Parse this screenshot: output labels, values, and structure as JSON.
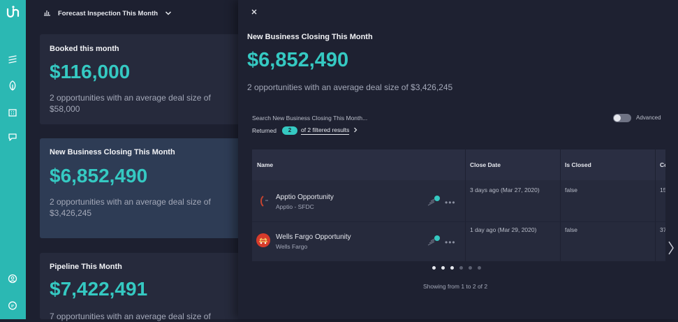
{
  "header": {
    "title": "Forecast Inspection This Month"
  },
  "cards": [
    {
      "title": "Booked this month",
      "value": "$116,000",
      "subtitle": "2 opportunities with an average deal size of $58,000"
    },
    {
      "title": "New Business Closing This Month",
      "value": "$6,852,490",
      "subtitle": "2 opportunities with an average deal size of $3,426,245"
    },
    {
      "title": "Pipeline This Month",
      "value": "$7,422,491",
      "subtitle": "7 opportunities with an average deal size of"
    }
  ],
  "panel": {
    "title": "New Business Closing This Month",
    "value": "$6,852,490",
    "subtitle": "2 opportunities with an average deal size of $3,426,245",
    "search_placeholder": "Search New Business Closing This Month...",
    "returned_label": "Returned",
    "returned_count": "2",
    "filtered_label": "of 2 filtered results",
    "advanced_label": "Advanced",
    "columns": [
      "Name",
      "Close Date",
      "Is Closed",
      "Co"
    ],
    "rows": [
      {
        "name": "Apptio Opportunity",
        "account": "Apptio - SFDC",
        "close_date": "3 days ago (Mar 27, 2020)",
        "is_closed": "false",
        "extra": "15"
      },
      {
        "name": "Wells Fargo Opportunity",
        "account": "Wells Fargo",
        "close_date": "1 day ago (Mar 29, 2020)",
        "is_closed": "false",
        "extra": "37"
      }
    ],
    "more_label": "•••",
    "showing": "Showing from 1 to 2 of 2",
    "pagination": {
      "total_dots": 6,
      "active_dots": 3
    }
  },
  "colors": {
    "accent": "#35c9c2",
    "rail": "#2bb8b3",
    "background": "#1d2030"
  },
  "icons": [
    "logo-icon",
    "list-icon",
    "leaf-icon",
    "building-icon",
    "chat-bubble-icon",
    "user-circle-icon",
    "help-bubble-icon",
    "bar-chart-icon",
    "chevron-down-icon",
    "close-icon",
    "chevron-right-icon",
    "activity-icon"
  ]
}
